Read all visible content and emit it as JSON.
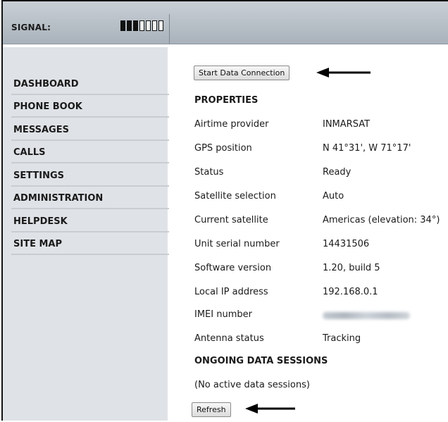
{
  "header": {
    "signal_label": "SIGNAL:",
    "signal_level": 3,
    "signal_max": 7
  },
  "sidebar": {
    "items": [
      {
        "label": "DASHBOARD"
      },
      {
        "label": "PHONE BOOK"
      },
      {
        "label": "MESSAGES"
      },
      {
        "label": "CALLS"
      },
      {
        "label": "SETTINGS"
      },
      {
        "label": "ADMINISTRATION"
      },
      {
        "label": "HELPDESK"
      },
      {
        "label": "SITE MAP"
      }
    ]
  },
  "main": {
    "start_button_label": "Start Data Connection",
    "properties_title": "PROPERTIES",
    "properties": [
      {
        "key": "Airtime provider",
        "value": "INMARSAT"
      },
      {
        "key": "GPS position",
        "value": "N 41°31', W 71°17'"
      },
      {
        "key": "Status",
        "value": "Ready"
      },
      {
        "key": "Satellite selection",
        "value": "Auto"
      },
      {
        "key": "Current satellite",
        "value": "Americas (elevation: 34°)"
      },
      {
        "key": "Unit serial number",
        "value": "14431506"
      },
      {
        "key": "Software version",
        "value": "1.20, build 5"
      },
      {
        "key": "Local IP address",
        "value": "192.168.0.1"
      },
      {
        "key": "IMEI number",
        "value": "",
        "redacted": true
      },
      {
        "key": "Antenna status",
        "value": "Tracking"
      }
    ],
    "sessions_title": "ONGOING DATA SESSIONS",
    "sessions_note": "(No active data sessions)",
    "refresh_button_label": "Refresh"
  },
  "colors": {
    "sidebar_bg": "#dfe2e6",
    "topbar_bg": "#b8c0c8",
    "divider": "#c9ccd0"
  }
}
